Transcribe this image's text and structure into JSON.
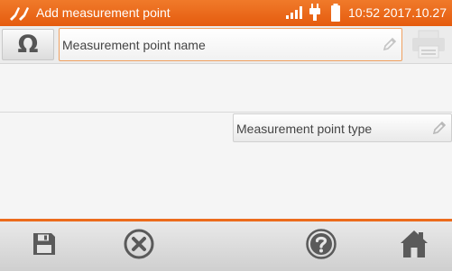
{
  "header": {
    "title": "Add measurement point",
    "time": "10:52 2017.10.27",
    "icons": [
      "probes-icon",
      "signal-icon",
      "plug-icon",
      "battery-icon"
    ]
  },
  "toolbar": {
    "omega_label": "Ω",
    "icons": [
      "pencil-icon",
      "printer-icon"
    ]
  },
  "fields": {
    "name_placeholder": "Measurement point name",
    "type_placeholder": "Measurement point type"
  },
  "footer": {
    "icons": [
      "save-icon",
      "cancel-icon",
      "help-icon",
      "home-icon"
    ]
  },
  "colors": {
    "accent": "#e8600f",
    "icon_gray": "#5a5a5a"
  }
}
